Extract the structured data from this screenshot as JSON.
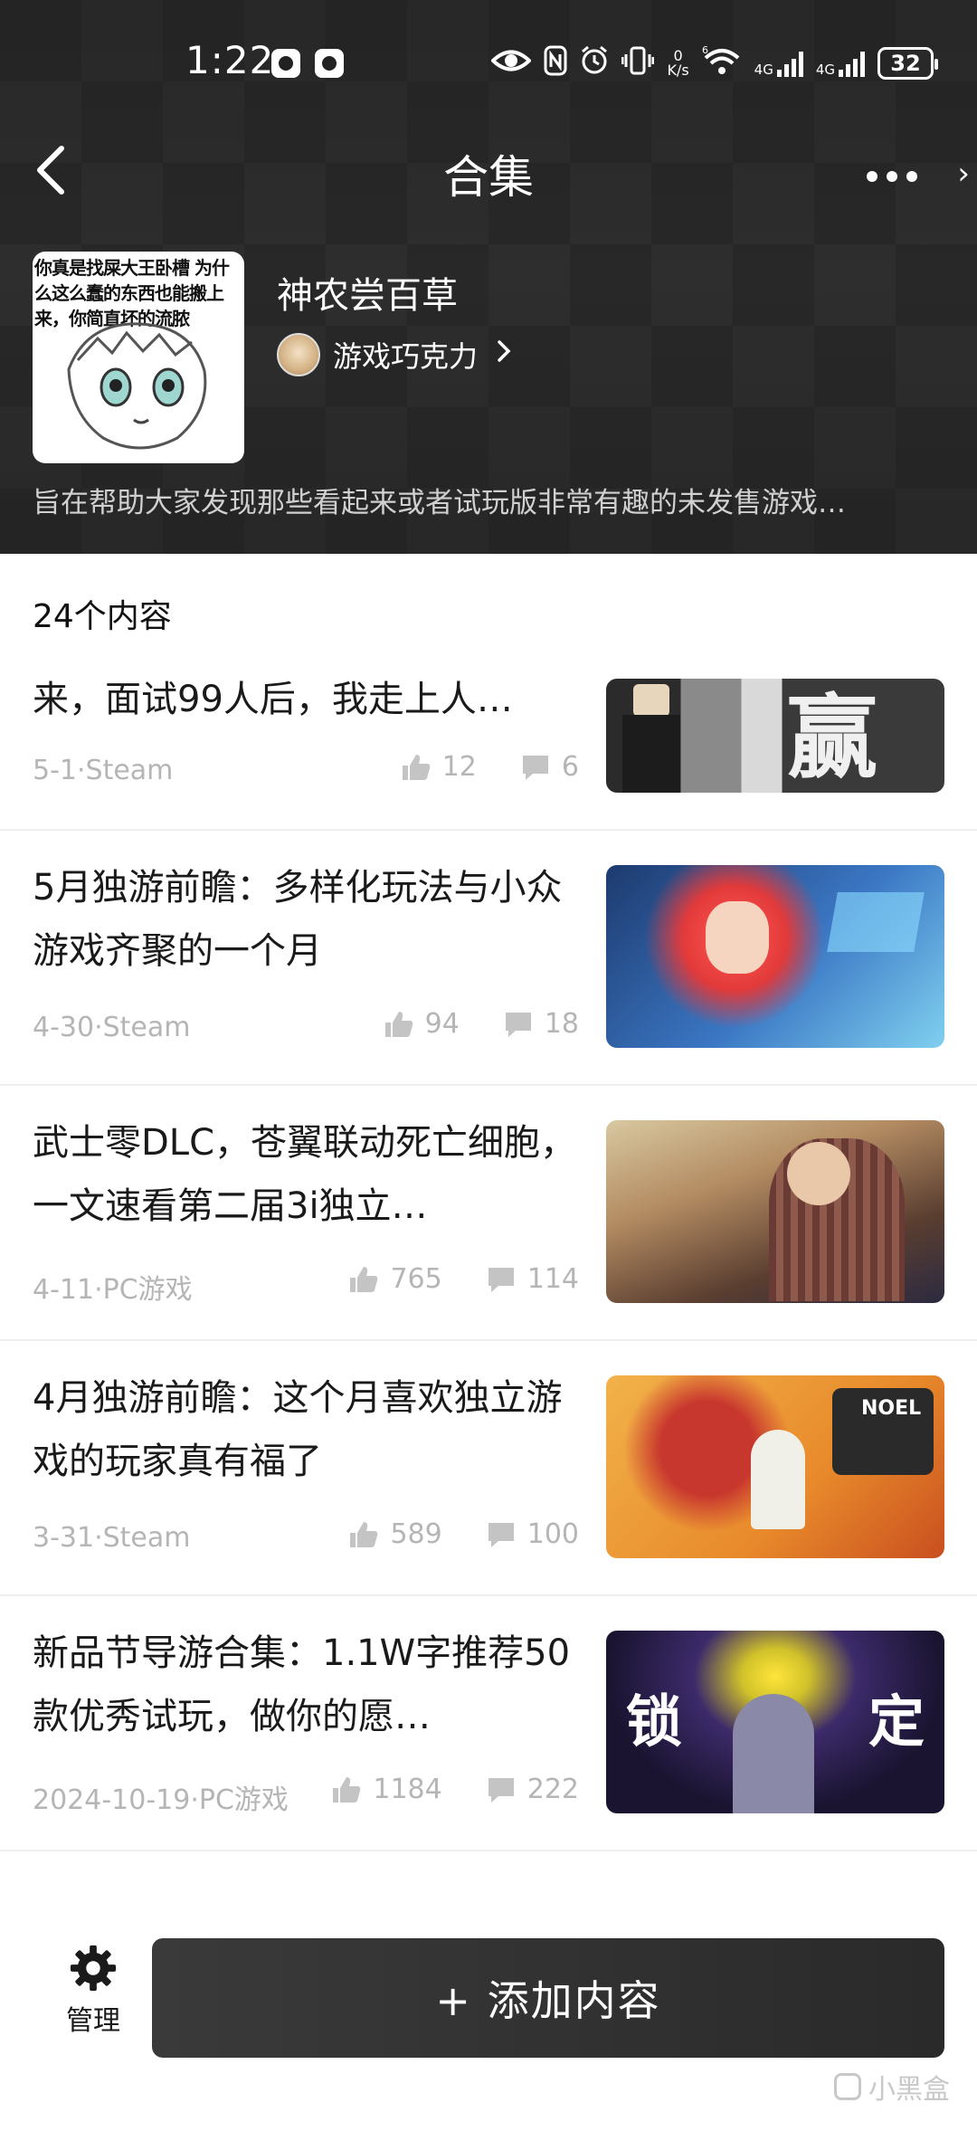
{
  "status_bar": {
    "time": "1:22",
    "net_speed_top": "0",
    "net_speed_bottom": "K/s",
    "wifi_tag": "6",
    "sim1_tag": "4G",
    "sim2_tag": "4G",
    "battery": "32"
  },
  "nav": {
    "title": "合集",
    "back_icon": "back-chevron-icon",
    "more_icon": "more-dots-icon"
  },
  "collection": {
    "cover_caption": "你真是找屎大王卧槽 为什么这么蠢的东西也能搬上来，你简直坏的流脓",
    "title": "神农尝百草",
    "author": "游戏巧克力",
    "description": "旨在帮助大家发现那些看起来或者试玩版非常有趣的未发售游戏…"
  },
  "list": {
    "count_label": "24个内容",
    "items": [
      {
        "title": "来，面试99人后，我走上人…",
        "meta": "5-1·Steam",
        "likes": "12",
        "comments": "6"
      },
      {
        "title": "5月独游前瞻：多样化玩法与小众游戏齐聚的一个月",
        "meta": "4-30·Steam",
        "likes": "94",
        "comments": "18"
      },
      {
        "title": "武士零DLC，苍翼联动死亡细胞，一文速看第二届3i独立…",
        "meta": "4-11·PC游戏",
        "likes": "765",
        "comments": "114"
      },
      {
        "title": "4月独游前瞻：这个月喜欢独立游戏的玩家真有福了",
        "meta": "3-31·Steam",
        "likes": "589",
        "comments": "100"
      },
      {
        "title": "新品节导游合集：1.1W字推荐50款优秀试玩，做你的愿…",
        "meta": "2024-10-19·PC游戏",
        "likes": "1184",
        "comments": "222"
      }
    ],
    "thumb_text": {
      "item0": "赢",
      "item3": "NOEL",
      "item4_left": "锁",
      "item4_right": "定"
    }
  },
  "bottom": {
    "manage_label": "管理",
    "add_label": "+ 添加内容",
    "watermark": "小黑盒"
  },
  "colors": {
    "header_bg": "#2b2b2b",
    "button_bg": "#2f2f2f",
    "meta_text": "#b5b5b5"
  }
}
